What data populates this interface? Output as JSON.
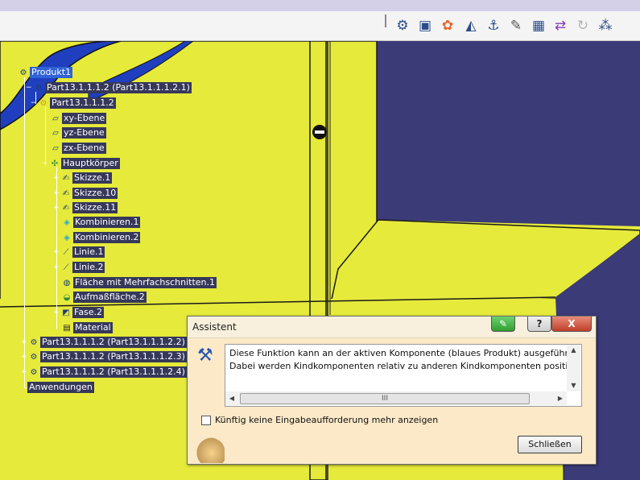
{
  "toolbar": {
    "icons": [
      "product-icon",
      "part-icon",
      "components-icon",
      "plane-icon",
      "anchor-icon",
      "pencil-icon",
      "table-icon",
      "switch-icon",
      "cycle-icon",
      "grid-icon"
    ]
  },
  "tree": {
    "root": "Produkt1",
    "items": [
      {
        "label": "Part13.1.1.1.2 (Part13.1.1.1.2.1)"
      },
      {
        "label": "Part13.1.1.1.2"
      },
      {
        "label": "xy-Ebene"
      },
      {
        "label": "yz-Ebene"
      },
      {
        "label": "zx-Ebene"
      },
      {
        "label": "Hauptkörper"
      },
      {
        "label": "Skizze.1"
      },
      {
        "label": "Skizze.10"
      },
      {
        "label": "Skizze.11"
      },
      {
        "label": "Kombinieren.1"
      },
      {
        "label": "Kombinieren.2"
      },
      {
        "label": "Linie.1"
      },
      {
        "label": "Linie.2"
      },
      {
        "label": "Fläche mit Mehrfachschnitten.1"
      },
      {
        "label": "Aufmaßfläche.2"
      },
      {
        "label": "Fase.2"
      },
      {
        "label": "Material"
      },
      {
        "label": "Part13.1.1.1.2 (Part13.1.1.1.2.2)"
      },
      {
        "label": "Part13.1.1.1.2 (Part13.1.1.1.2.3)"
      },
      {
        "label": "Part13.1.1.1.2 (Part13.1.1.1.2.4)"
      },
      {
        "label": "Anwendungen"
      }
    ]
  },
  "dialog": {
    "title": "Assistent",
    "message_line1": "Diese Funktion kann an der aktiven Komponente (blaues Produkt) ausgeführt w",
    "message_line2": "Dabei werden Kindkomponenten relativ zu anderen Kindkomponenten position",
    "scroll_thumb_label": "III",
    "checkbox_label": "Künftig keine Eingabeaufforderung mehr anzeigen",
    "close_button_label": "Schließen",
    "help_label": "?",
    "close_x_label": "X"
  },
  "colors": {
    "background": "#3b3b78",
    "part_yellow": "#e6ea3a",
    "edge": "#1a1a1a",
    "tree_label_bg": "#36385a",
    "selected_bg": "#2f63d6",
    "dialog_bg": "#fbe9c8"
  }
}
